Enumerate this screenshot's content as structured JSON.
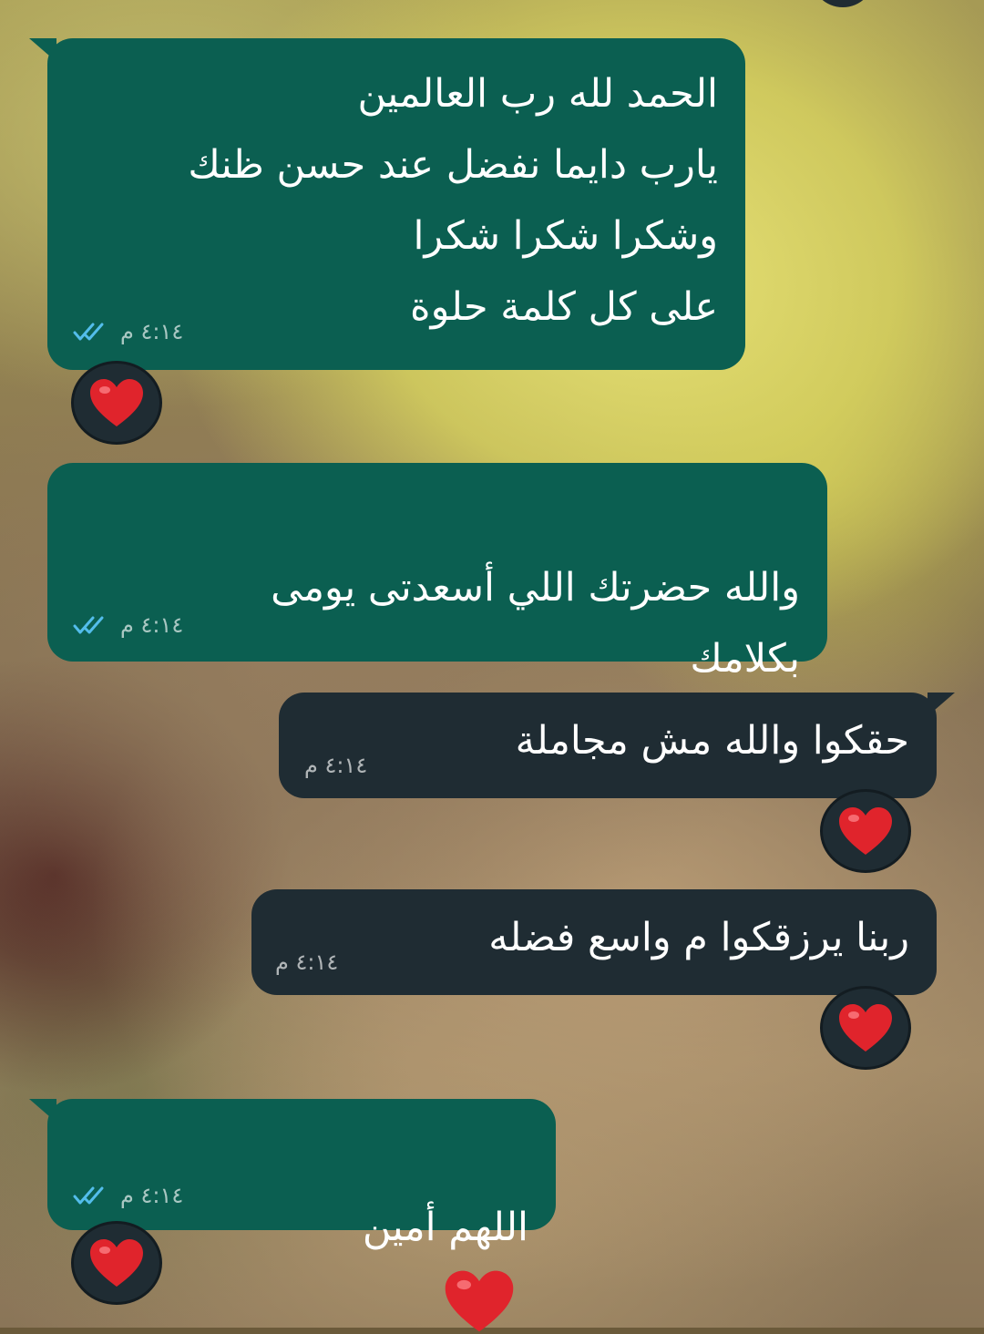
{
  "messages": [
    {
      "id": "m1",
      "direction": "outgoing",
      "text": "الحمد لله رب العالمين\nيارب دايما نفضل عند حسن ظنك\nوشكرا شكرا شكرا\nعلى كل كلمة حلوة",
      "time": "٤:١٤ م",
      "status": "read",
      "reaction": "❤️"
    },
    {
      "id": "m2",
      "direction": "outgoing",
      "text": "والله حضرتك اللي أسعدتى يومى\nبكلامك",
      "inline_emoji": "❤️",
      "time": "٤:١٤ م",
      "status": "read"
    },
    {
      "id": "m3",
      "direction": "incoming",
      "text": "حقكوا والله مش مجاملة",
      "time": "٤:١٤ م",
      "reaction": "❤️"
    },
    {
      "id": "m4",
      "direction": "incoming",
      "text": "ربنا يرزقكوا م واسع فضله",
      "time": "٤:١٤ م",
      "reaction": "❤️"
    },
    {
      "id": "m5",
      "direction": "outgoing",
      "text": "اللهم أمين",
      "inline_emoji": "❤️",
      "time": "٤:١٤ م",
      "status": "read",
      "reaction": "❤️"
    }
  ],
  "colors": {
    "outgoing_bubble": "#0b5f51",
    "incoming_bubble": "#1f2c33",
    "read_ticks": "#53bdeb",
    "heart": "#e0242c"
  },
  "icons": {
    "read_status": "double-check-icon",
    "reaction": "red-heart-icon"
  }
}
